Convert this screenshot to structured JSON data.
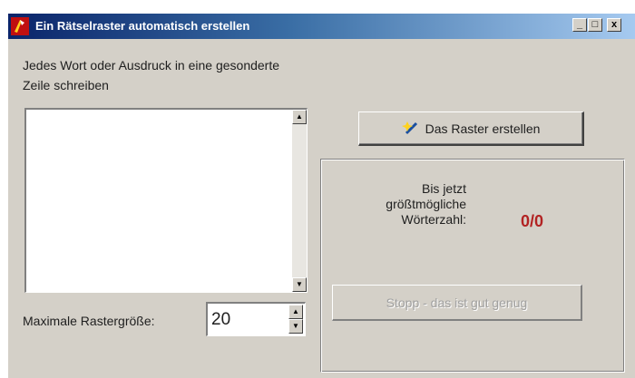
{
  "window": {
    "title": "Ein Rätselraster automatisch erstellen",
    "controls": {
      "minimize": "_",
      "maximize": "□",
      "close": "x"
    }
  },
  "instructions": "Jedes Wort oder Ausdruck in eine gesonderte Zeile schreiben",
  "word_list": {
    "value": ""
  },
  "max_size": {
    "label": "Maximale Rastergröße:",
    "value": "20"
  },
  "create_button": {
    "label": "Das Raster erstellen",
    "icon": "magic-wand-icon"
  },
  "status": {
    "label_lines": [
      "Bis jetzt",
      "größtmögliche",
      "Wörterzahl:"
    ],
    "count": "0/0",
    "count_color": "#b22222"
  },
  "stop_button": {
    "label": "Stopp - das ist gut genug",
    "enabled": false
  },
  "colors": {
    "title_gradient_start": "#0a246a",
    "title_gradient_end": "#a6caf0",
    "face": "#d4d0c8"
  }
}
